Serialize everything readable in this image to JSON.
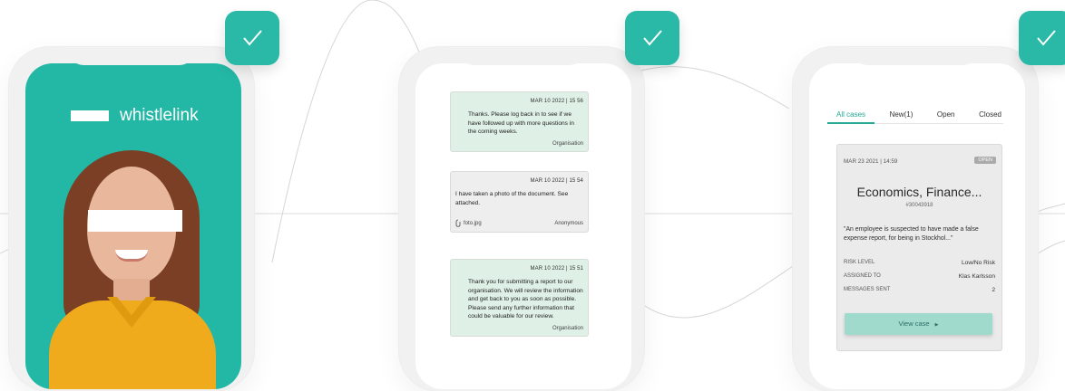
{
  "app": {
    "logo_text": "whistlelink"
  },
  "colors": {
    "brand_teal": "#23b8a5",
    "check_teal": "#29b9a6",
    "message_green": "#dff0e6",
    "message_gray": "#eeeeee",
    "tab_active": "#23a996"
  },
  "icons": {
    "check": "checkmark-icon",
    "attachment": "paperclip-icon",
    "button_arrow": "triangle-right-icon"
  },
  "messages": [
    {
      "date": "MAR 10 2022 | 15  56",
      "text": "Thanks. Please log back in to see if we have followed up with more questions in the coming weeks.",
      "sender": "Organisation"
    },
    {
      "date": "MAR 10 2022 | 15  54",
      "text": "I have taken a photo of the document. See attached.",
      "attachment": "foto.jpg",
      "sender": "Anonymous"
    },
    {
      "date": "MAR 10 2022 | 15  51",
      "text": "Thank you for submitting a report to our organisation. We will review the information and get back to you as soon as possible. Please send any further information that could be valuable for our review.",
      "sender": "Organisation"
    }
  ],
  "cases": {
    "tabs": [
      {
        "label": "All cases",
        "active": true
      },
      {
        "label": "New(1)",
        "active": false
      },
      {
        "label": "Open",
        "active": false
      },
      {
        "label": "Closed",
        "active": false
      }
    ],
    "card": {
      "date": "MAR 23 2021 | 14:59",
      "status": "OPEN",
      "title": "Economics, Finance...",
      "id": "#30043918",
      "description": "\"An employee is suspected to have made a false expense report, for being in Stockhol...\"",
      "risk_label": "RISK LEVEL",
      "risk_value": "Low/No Risk",
      "assigned_label": "ASSIGNED TO",
      "assigned_value": "Klas Karlsson",
      "messages_label": "MESSAGES SENT",
      "messages_value": "2",
      "button_label": "View case"
    }
  }
}
